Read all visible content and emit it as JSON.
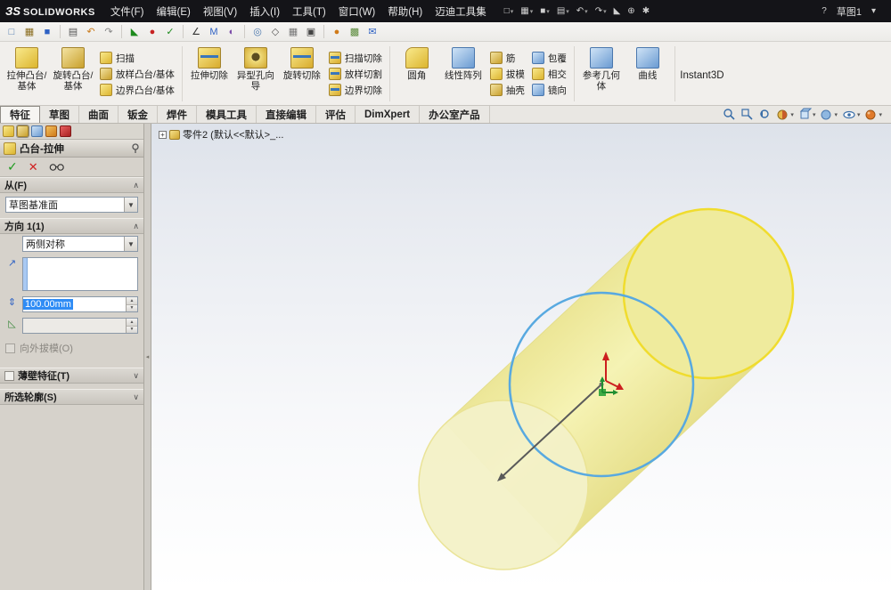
{
  "colors": {
    "accent_blue": "#2f8cf5",
    "cylinder_yellow": "#f0eda0",
    "sketch_blue": "#58a9e0",
    "highlight_yellow": "#f2df2e"
  },
  "titlebar": {
    "logo_mark": "ЗS",
    "logo_text": "SOLIDWORKS",
    "menus": [
      "文件(F)",
      "编辑(E)",
      "视图(V)",
      "插入(I)",
      "工具(T)",
      "窗口(W)",
      "帮助(H)",
      "迈迪工具集"
    ],
    "doc_name": "草图1"
  },
  "ribbon": {
    "large": [
      "拉伸凸台/基体",
      "旋转凸台/基体",
      "拉伸切除",
      "异型孔向导",
      "旋转切除",
      "圆角",
      "线性阵列",
      "参考几何体",
      "曲线",
      "Instant3D"
    ],
    "small": [
      "扫描",
      "放样凸台/基体",
      "边界凸台/基体",
      "扫描切除",
      "放样切割",
      "边界切除",
      "筋",
      "拔模",
      "抽壳",
      "包覆",
      "相交",
      "镜向"
    ]
  },
  "tabs": [
    "特征",
    "草图",
    "曲面",
    "钣金",
    "焊件",
    "模具工具",
    "直接编辑",
    "评估",
    "DimXpert",
    "办公室产品"
  ],
  "tree": {
    "root_label": "零件2 (默认<<默认>_..."
  },
  "panel": {
    "title": "凸台-拉伸",
    "from": {
      "label": "从(F)",
      "value": "草图基准面"
    },
    "direction1": {
      "label": "方向 1(1)",
      "end_condition": "两侧对称",
      "depth": "100.00mm",
      "draft_outward_label": "向外拔模(O)"
    },
    "thin_feature_label": "薄壁特征(T)",
    "selected_contours_label": "所选轮廓(S)"
  }
}
